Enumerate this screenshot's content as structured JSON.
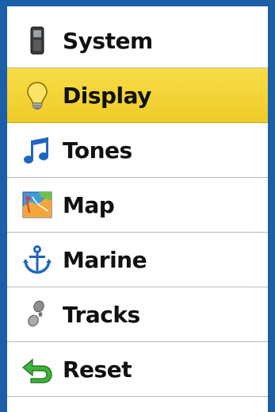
{
  "menu": {
    "items": [
      {
        "label": "System",
        "icon": "device-icon"
      },
      {
        "label": "Display",
        "icon": "lightbulb-icon",
        "selected": true
      },
      {
        "label": "Tones",
        "icon": "music-note-icon"
      },
      {
        "label": "Map",
        "icon": "map-icon"
      },
      {
        "label": "Marine",
        "icon": "anchor-icon"
      },
      {
        "label": "Tracks",
        "icon": "footprints-icon"
      },
      {
        "label": "Reset",
        "icon": "reset-arrow-icon"
      }
    ]
  },
  "colors": {
    "frame": "#1a5fa8",
    "selected": "#f4d33a",
    "divider": "#b9b9b9"
  }
}
